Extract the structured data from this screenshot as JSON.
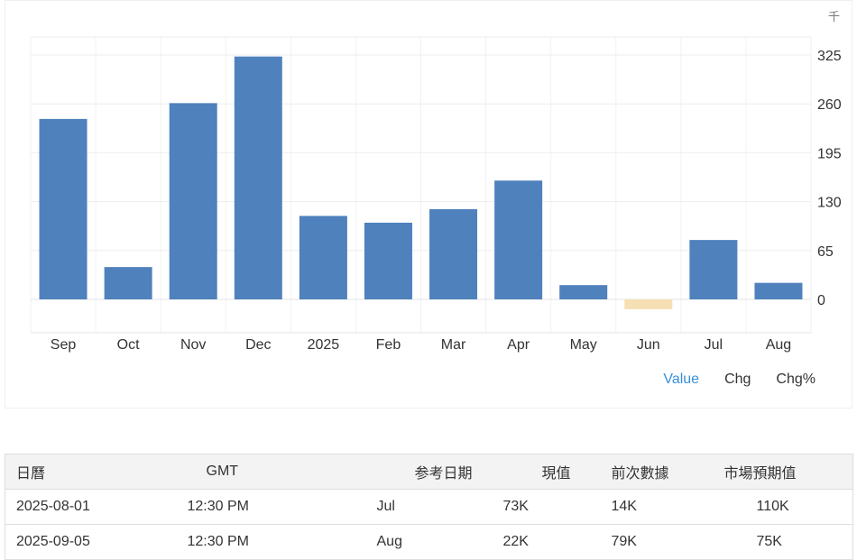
{
  "chart_data": {
    "type": "bar",
    "unit": "千",
    "categories": [
      "Sep",
      "Oct",
      "Nov",
      "Dec",
      "2025",
      "Feb",
      "Mar",
      "Apr",
      "May",
      "Jun",
      "Jul",
      "Aug"
    ],
    "values": [
      240,
      43,
      261,
      323,
      111,
      102,
      120,
      158,
      19,
      -13,
      79,
      22
    ],
    "yticks": [
      0,
      65,
      130,
      195,
      260,
      325
    ],
    "ylim": [
      -40,
      345
    ],
    "grid": true,
    "colors": {
      "positive": "#4f81bd",
      "negative": "#f5dfb3"
    },
    "legend": {
      "placement": "bottom-right",
      "items": [
        "Value",
        "Chg",
        "Chg%"
      ],
      "active": "Value"
    }
  },
  "table": {
    "headers": [
      "日曆",
      "GMT",
      "参考日期",
      "現值",
      "前次數據",
      "市場預期值"
    ],
    "rows": [
      [
        "2025-08-01",
        "12:30 PM",
        "Jul",
        "73K",
        "14K",
        "110K"
      ],
      [
        "2025-09-05",
        "12:30 PM",
        "Aug",
        "22K",
        "79K",
        "75K"
      ]
    ]
  }
}
